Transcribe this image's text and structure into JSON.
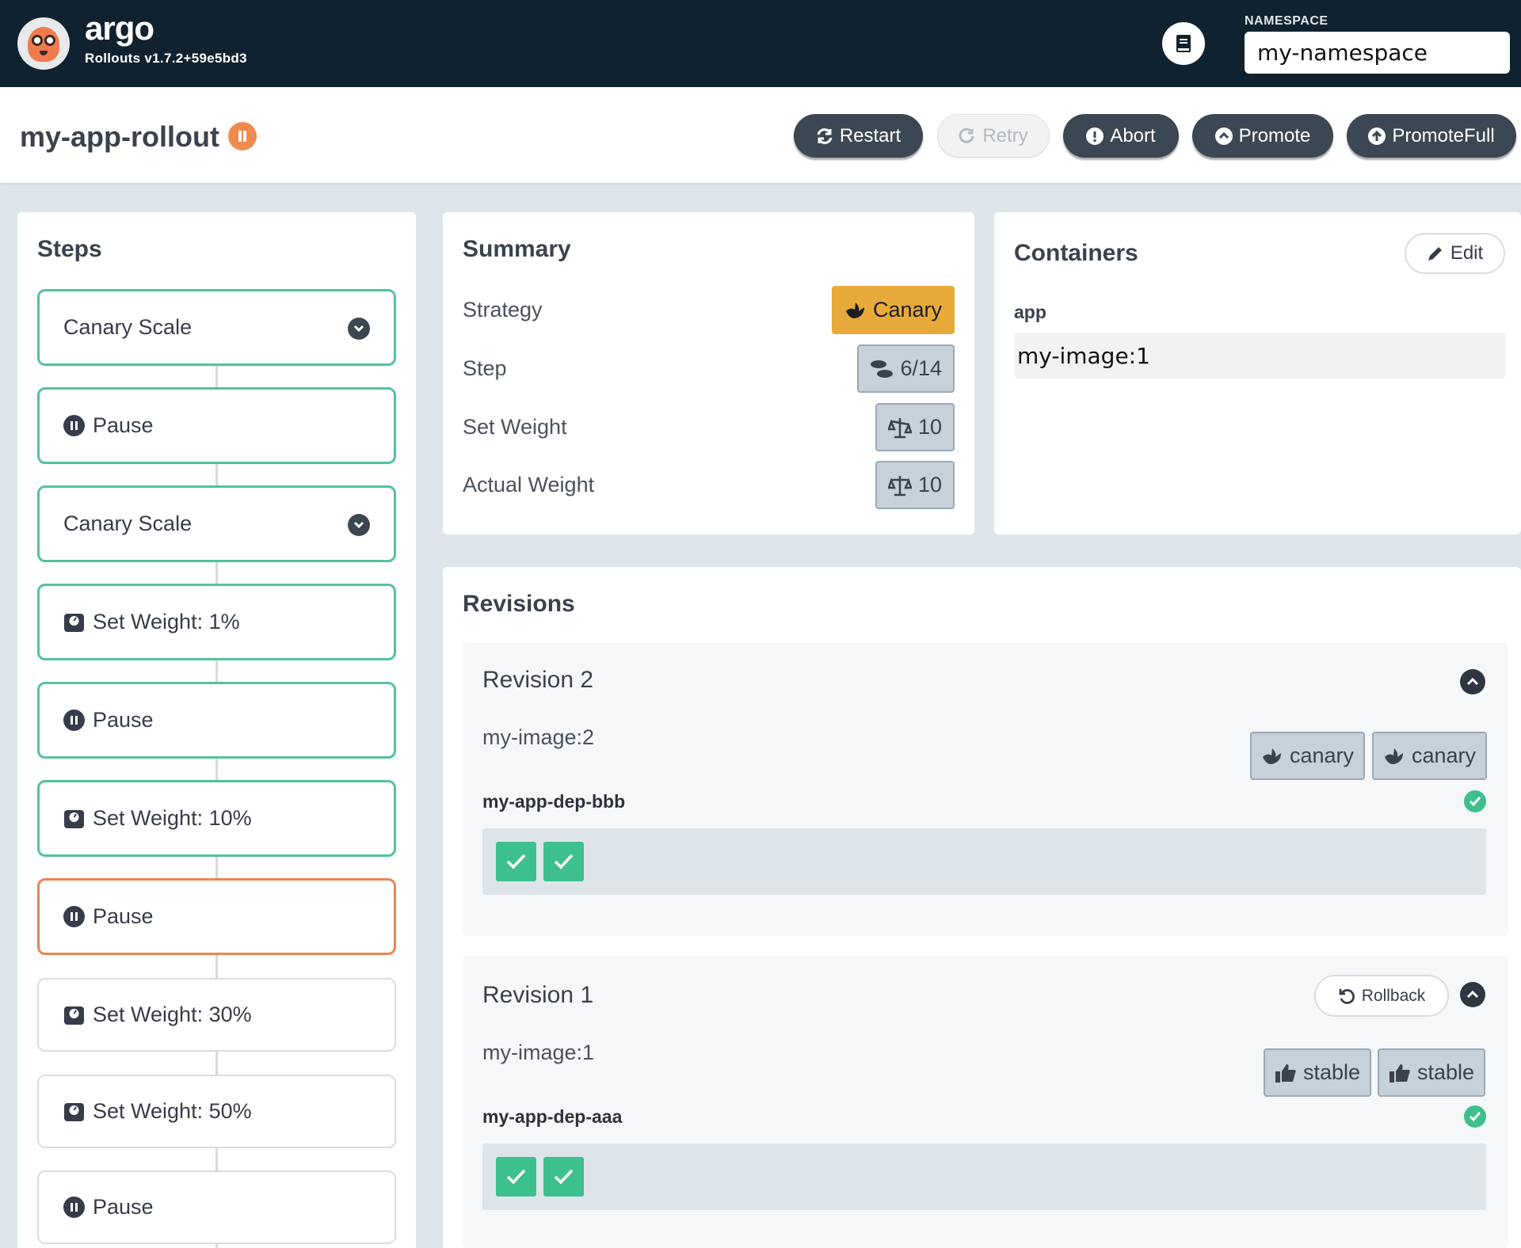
{
  "app": {
    "brand_name": "argo",
    "version": "Rollouts v1.7.2+59e5bd3",
    "docs_icon": "book-icon"
  },
  "namespace": {
    "label": "NAMESPACE",
    "value": "my-namespace"
  },
  "rollout": {
    "name": "my-app-rollout",
    "status": "paused",
    "status_color": "#ef8a4f"
  },
  "actions": {
    "restart": "Restart",
    "retry": "Retry",
    "abort": "Abort",
    "promote": "Promote",
    "promote_full": "PromoteFull"
  },
  "steps": {
    "title": "Steps",
    "items": [
      {
        "label": "Canary Scale",
        "icon": "chevron-down-icon",
        "state": "complete"
      },
      {
        "label": "Pause",
        "icon": "pause-icon",
        "state": "complete"
      },
      {
        "label": "Canary Scale",
        "icon": "chevron-down-icon",
        "state": "complete"
      },
      {
        "label": "Set Weight: 1%",
        "icon": "weight-icon",
        "state": "complete"
      },
      {
        "label": "Pause",
        "icon": "pause-icon",
        "state": "complete"
      },
      {
        "label": "Set Weight: 10%",
        "icon": "weight-icon",
        "state": "complete"
      },
      {
        "label": "Pause",
        "icon": "pause-icon",
        "state": "current"
      },
      {
        "label": "Set Weight: 30%",
        "icon": "weight-icon",
        "state": "pending"
      },
      {
        "label": "Set Weight: 50%",
        "icon": "weight-icon",
        "state": "pending"
      },
      {
        "label": "Pause",
        "icon": "pause-icon",
        "state": "pending"
      }
    ]
  },
  "summary": {
    "title": "Summary",
    "strategy_label": "Strategy",
    "strategy_value": "Canary",
    "step_label": "Step",
    "step_value": "6/14",
    "set_weight_label": "Set Weight",
    "set_weight_value": "10",
    "actual_weight_label": "Actual Weight",
    "actual_weight_value": "10"
  },
  "containers": {
    "title": "Containers",
    "edit_label": "Edit",
    "name": "app",
    "image": "my-image:1"
  },
  "revisions": {
    "title": "Revisions",
    "items": [
      {
        "title": "Revision 2",
        "image": "my-image:2",
        "replicaset": "my-app-dep-bbb",
        "tags": [
          "canary",
          "canary"
        ],
        "pods": 2
      },
      {
        "title": "Revision 1",
        "image": "my-image:1",
        "replicaset": "my-app-dep-aaa",
        "rollback_label": "Rollback",
        "tags": [
          "stable",
          "stable"
        ],
        "pods": 2
      }
    ]
  },
  "colors": {
    "topbar": "#10222f",
    "step_complete": "#52c39e",
    "step_current": "#ec8453",
    "canary_badge": "#e7aa3b",
    "pod_ok": "#3ec08c",
    "button_dark": "#3b4752"
  }
}
